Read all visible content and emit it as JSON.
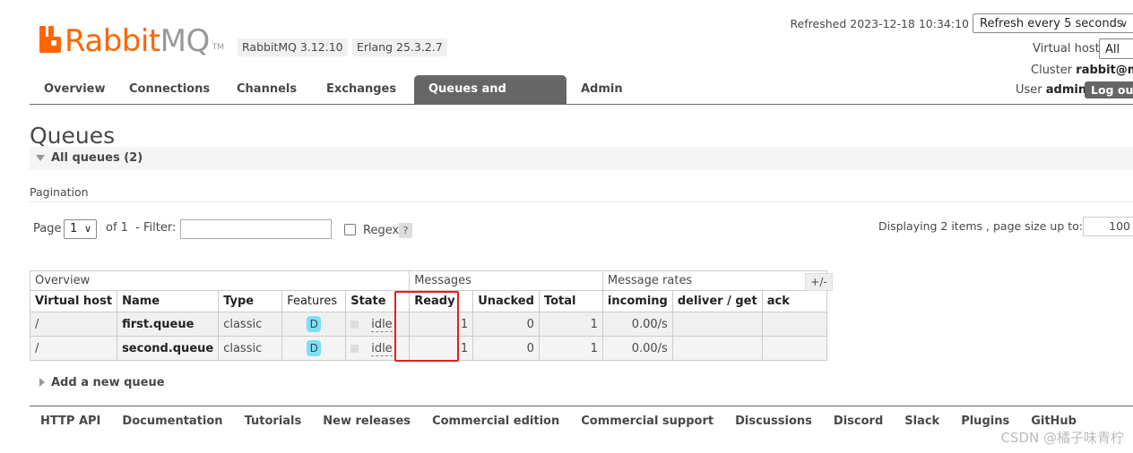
{
  "header": {
    "logo_rabbit": "Rabbit",
    "logo_mq": "MQ",
    "logo_tm": "TM",
    "version_rabbitmq": "RabbitMQ 3.12.10",
    "version_erlang": "Erlang 25.3.2.7",
    "refreshed": "Refreshed 2023-12-18 10:34:10",
    "refresh_select": "Refresh every 5 seconds",
    "virtual_host_label": "Virtual host",
    "virtual_host_value": "All",
    "cluster_label": "Cluster",
    "cluster_value": "rabbit@mo",
    "user_label": "User",
    "user_value": "admin",
    "logout_label": "Log out"
  },
  "nav": {
    "items": [
      "Overview",
      "Connections",
      "Channels",
      "Exchanges",
      "Queues and Streams",
      "Admin"
    ],
    "active": "Queues and Streams"
  },
  "page": {
    "title": "Queues",
    "section_title": "All queues (2)",
    "pagination_label": "Pagination",
    "page_label": "Page",
    "page_value": "1",
    "of_filter": "of 1  - Filter:",
    "filter_value": "",
    "regex_label": "Regex",
    "help_label": "?",
    "displaying": "Displaying 2 items , page size up to:",
    "page_size": "100"
  },
  "table": {
    "groups": [
      "Overview",
      "Messages",
      "Message rates"
    ],
    "columns": [
      "Virtual host",
      "Name",
      "Type",
      "Features",
      "State",
      "Ready",
      "Unacked",
      "Total",
      "incoming",
      "deliver / get",
      "ack"
    ],
    "rows": [
      {
        "vhost": "/",
        "name": "first.queue",
        "type": "classic",
        "feature": "D",
        "state": "idle",
        "ready": "1",
        "unacked": "0",
        "total": "1",
        "incoming": "0.00/s",
        "deliver_get": "",
        "ack": ""
      },
      {
        "vhost": "/",
        "name": "second.queue",
        "type": "classic",
        "feature": "D",
        "state": "idle",
        "ready": "1",
        "unacked": "0",
        "total": "1",
        "incoming": "0.00/s",
        "deliver_get": "",
        "ack": ""
      }
    ],
    "plus_minus": "+/-"
  },
  "add_queue": "Add a new queue",
  "footer": [
    "HTTP API",
    "Documentation",
    "Tutorials",
    "New releases",
    "Commercial edition",
    "Commercial support",
    "Discussions",
    "Discord",
    "Slack",
    "Plugins",
    "GitHub"
  ],
  "watermark": "CSDN @橘子味青柠",
  "colors": {
    "brand": "#ff6600",
    "nav_active": "#666666",
    "highlight": "#e02020",
    "feature_badge": "#7ce0f5"
  }
}
